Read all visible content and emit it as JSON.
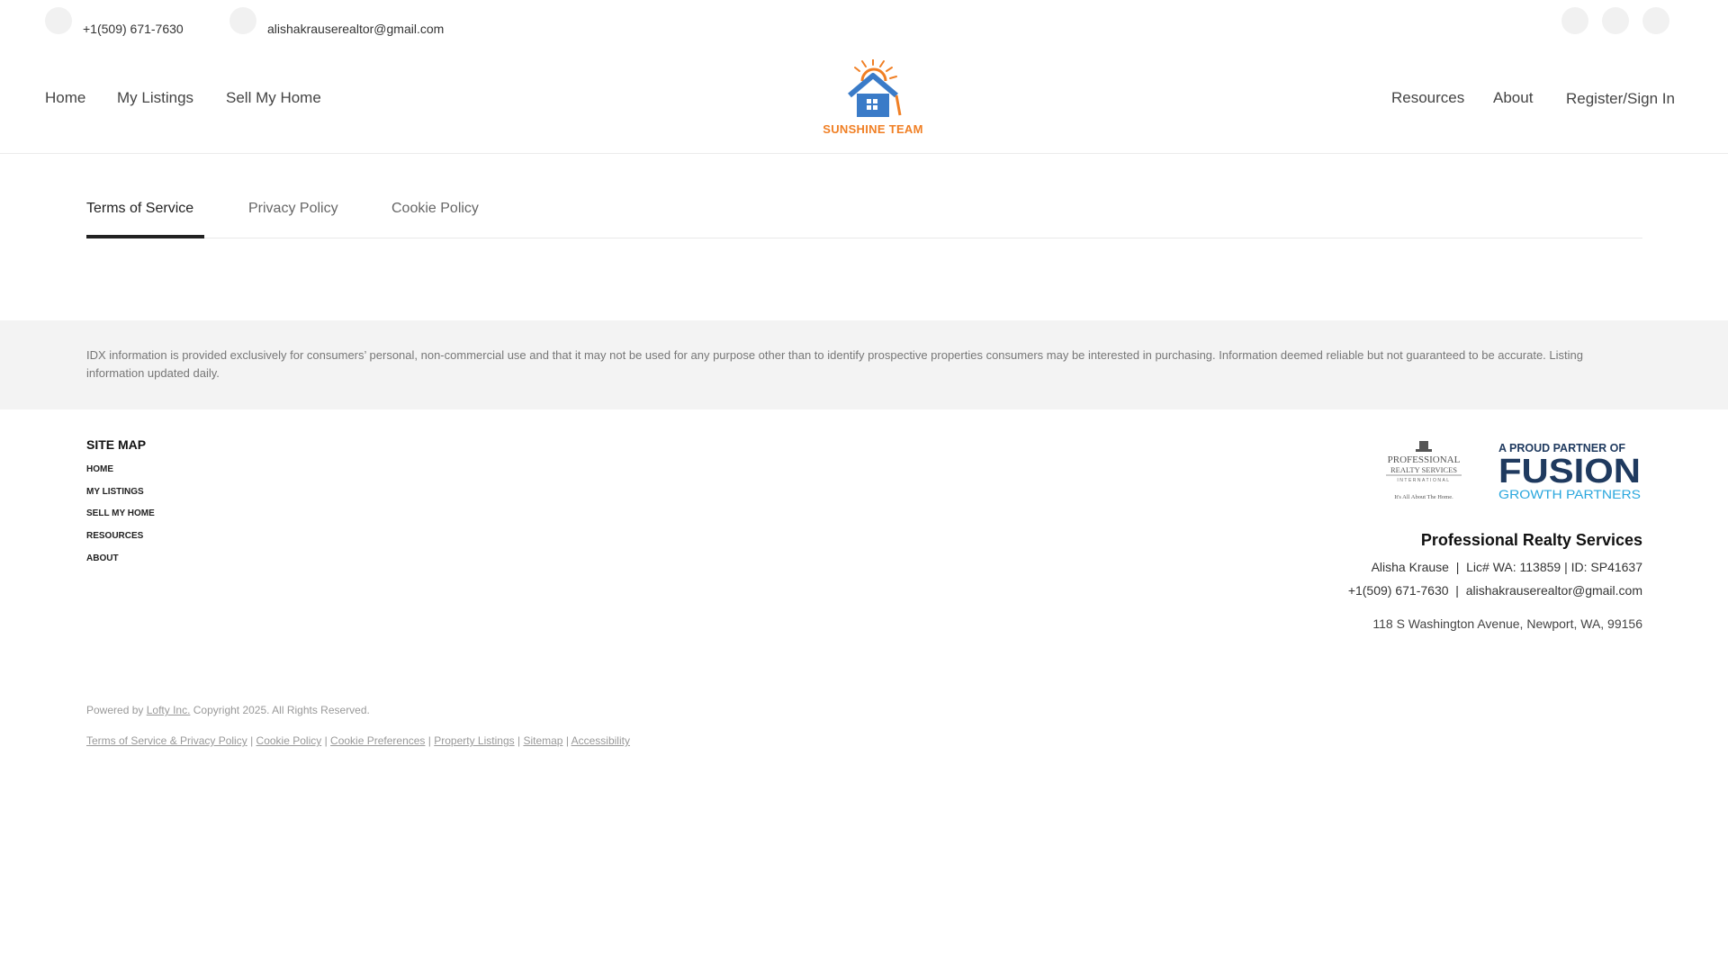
{
  "topbar": {
    "phone": "+1(509) 671-7630",
    "email": "alishakrauserealtor@gmail.com",
    "phone_icon": "phone-icon",
    "email_icon": "email-icon",
    "social_icons": [
      "facebook-icon",
      "instagram-icon",
      "linkedin-icon"
    ]
  },
  "nav": {
    "left": [
      "Home",
      "My Listings",
      "Sell My Home"
    ],
    "right": [
      "Resources",
      "About"
    ],
    "account": "Register/Sign In"
  },
  "logo": {
    "brand_text": "SUNSHINE TEAM"
  },
  "tabs": [
    "Terms of Service",
    "Privacy Policy",
    "Cookie Policy"
  ],
  "disclaimer": "IDX information is provided exclusively for consumers’ personal, non-commercial use and that it may not be used for any purpose other than to identify prospective properties consumers may be interested in purchasing. Information deemed reliable but not guaranteed to be accurate. Listing information updated daily.",
  "sitemap": {
    "title": "SITE MAP",
    "items": [
      "HOME",
      "MY LISTINGS",
      "SELL MY HOME",
      "RESOURCES",
      "ABOUT"
    ]
  },
  "partners": {
    "pro_line1": "PROFESSIONAL",
    "pro_line2": "REALTY SERVICES",
    "pro_line3": "INTERNATIONAL",
    "pro_tagline": "It's All About The Home.",
    "fusion_top": "A PROUD PARTNER OF",
    "fusion_main": "FUSION",
    "fusion_sub": "GROWTH PARTNERS"
  },
  "company": {
    "name": "Professional Realty Services",
    "agent_line": "Alisha Krause  |  Lic# WA: 113859 | ID: SP41637",
    "contact_line": "+1(509) 671-7630  |  alishakrauserealtor@gmail.com",
    "address": "118 S Washington Avenue, Newport, WA, 99156"
  },
  "footer": {
    "powered_prefix": "Powered by",
    "powered_link": "Lofty Inc.",
    "copyright": "Copyright 2025. All Rights Reserved.",
    "links": [
      "Terms of Service & Privacy Policy",
      "Cookie Policy",
      "Cookie Preferences",
      "Property Listings",
      "Sitemap",
      "Accessibility"
    ],
    "separator": "|"
  },
  "colors": {
    "brand_orange": "#f07f24",
    "brand_blue": "#3a7bc8",
    "fusion_navy": "#1f3a5f",
    "fusion_cyan": "#2aa7dd"
  }
}
